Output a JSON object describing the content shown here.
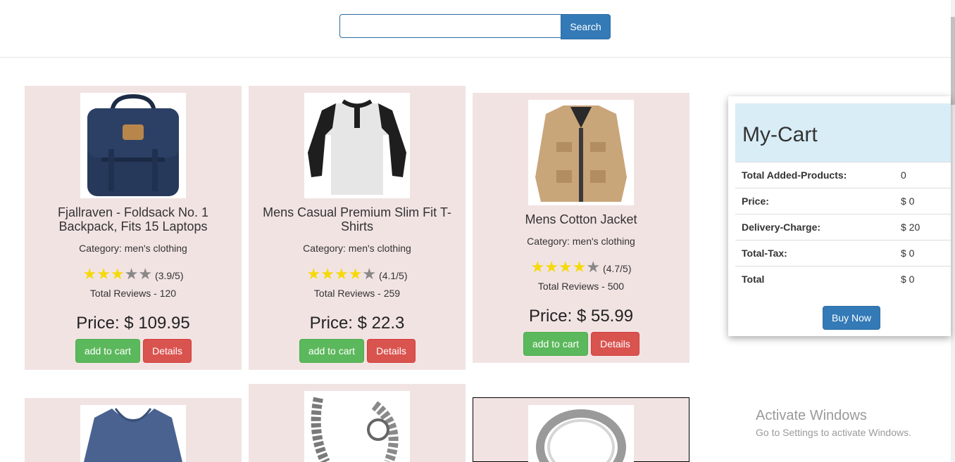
{
  "search": {
    "placeholder": "",
    "button_label": "Search"
  },
  "products": [
    {
      "title": "Fjallraven - Foldsack No. 1 Backpack, Fits 15 Laptops",
      "category": "Category: men's clothing",
      "stars": 3,
      "rating_text": "(3.9/5)",
      "reviews": "Total Reviews - 120",
      "price": "Price: $ 109.95",
      "add_label": "add to cart",
      "details_label": "Details",
      "image": "backpack-image"
    },
    {
      "title": "Mens Casual Premium Slim Fit T-Shirts",
      "category": "Category: men's clothing",
      "stars": 4,
      "rating_text": "(4.1/5)",
      "reviews": "Total Reviews - 259",
      "price": "Price: $ 22.3",
      "add_label": "add to cart",
      "details_label": "Details",
      "image": "tshirt-image"
    },
    {
      "title": "Mens Cotton Jacket",
      "category": "Category: men's clothing",
      "stars": 4,
      "rating_text": "(4.7/5)",
      "reviews": "Total Reviews - 500",
      "price": "Price: $ 55.99",
      "add_label": "add to cart",
      "details_label": "Details",
      "image": "jacket-image"
    },
    {
      "image": "sweater-image"
    },
    {
      "image": "bracelet-image"
    },
    {
      "image": "ring-image"
    }
  ],
  "cart": {
    "title": "My-Cart",
    "rows": [
      {
        "label": "Total Added-Products:",
        "value": "0"
      },
      {
        "label": "Price:",
        "value": "$ 0"
      },
      {
        "label": "Delivery-Charge:",
        "value": "$ 20"
      },
      {
        "label": "Total-Tax:",
        "value": "$ 0"
      },
      {
        "label": "Total",
        "value": "$ 0"
      }
    ],
    "buy_label": "Buy Now"
  },
  "watermark": {
    "line1": "Activate Windows",
    "line2": "Go to Settings to activate Windows."
  },
  "colors": {
    "card_bg": "#f2e3e3",
    "primary": "#337ab7",
    "success": "#5cb85c",
    "danger": "#d9534f",
    "star": "#f5d90a",
    "cart_head": "#d9edf7"
  }
}
